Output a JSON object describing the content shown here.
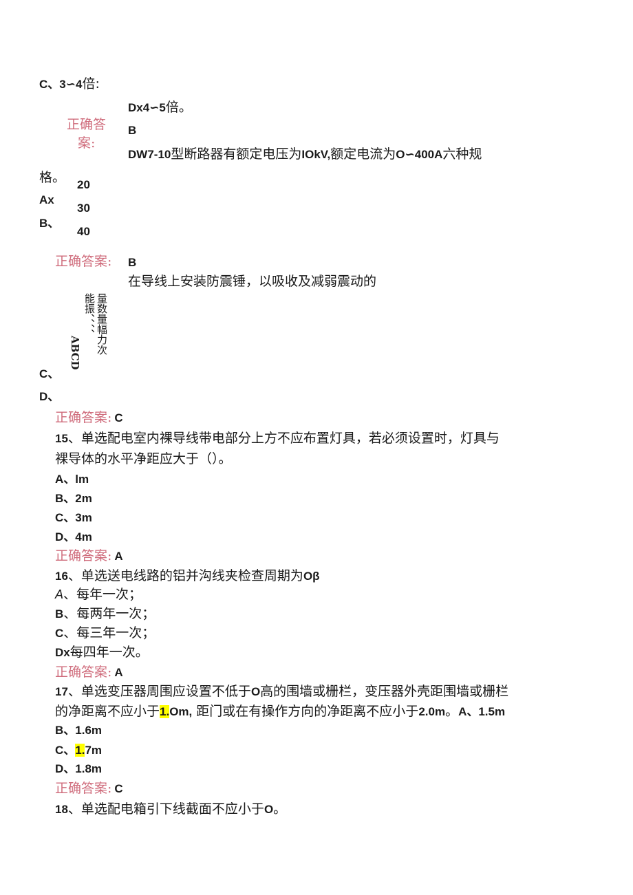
{
  "doc": {
    "q14_tail": {
      "option_c": {
        "label": "C、3∽4",
        "text": "倍:"
      },
      "option_d": {
        "label": "Dx4∽5",
        "text": "倍。"
      },
      "answer_label_line1": "正确答",
      "answer_label_line2": "案:",
      "answer": "B"
    },
    "q_dw7": {
      "stem": [
        "DW7-10",
        "型断路器有额定电压为",
        "IOkV,",
        "额定电流为",
        "O∽400A",
        "六种规"
      ],
      "stem_cont": "格。",
      "option_labels": [
        "Ax",
        "B、"
      ],
      "option_values": [
        "20",
        "30",
        "40"
      ],
      "answer_label": "正确答案:",
      "answer": "B"
    },
    "q_damper": {
      "stem": "在导线上安装防震锤，以吸收及减弱震动的",
      "vertical_col_right": "量数量幅力次",
      "vertical_col_middle": "能振、、、、",
      "vertical_col_left": "ABCD",
      "option_c": "C、",
      "option_d": "D、",
      "answer_label": "正确答案:",
      "answer": "C"
    },
    "q15": {
      "number": "15",
      "stem_line1": "、单选配电室内裸导线带电部分上方不应布置灯具，若必须设置时，灯具与",
      "stem_line2": "裸导体的水平净距应大于（）。",
      "options": [
        {
          "label": "A、",
          "value": "lm"
        },
        {
          "label": "B、",
          "value": "2m"
        },
        {
          "label": "C、",
          "value": "3m"
        },
        {
          "label": "D、",
          "value": "4m"
        }
      ],
      "answer_label": "正确答案:",
      "answer": "A"
    },
    "q16": {
      "number": "16",
      "stem": "、单选送电线路的铝并沟线夹检查周期为",
      "stem_end": "Oβ",
      "options": [
        {
          "label": "A",
          "text": "、每年一次；"
        },
        {
          "label": "B",
          "text": "、每两年一次；"
        },
        {
          "label": "C",
          "text": "、每三年一次；"
        },
        {
          "label": "Dx",
          "text": "每四年一次。"
        }
      ],
      "answer_label": "正确答案:",
      "answer": "A"
    },
    "q17": {
      "number": "17",
      "stem_line1_a": "、单选变压器周围应设置不低于",
      "stem_line1_b": "O",
      "stem_line1_c": "高的围墙或栅栏，变压器外壳距围墙或栅栏",
      "stem_line2_a": "的净距离不应小于",
      "stem_line2_hl": "1.",
      "stem_line2_b": "Om,",
      "stem_line2_c": " 距门或在有操作方向的净距离不应小于",
      "stem_line2_d": "2.0m",
      "stem_line2_e": "。",
      "option_a": "A、1.5m",
      "option_b": "B、1.6m",
      "option_c_label": "C、",
      "option_c_hl": "1.",
      "option_c_rest": "7m",
      "option_d": "D、1.8m",
      "answer_label": "正确答案:",
      "answer": "C"
    },
    "q18": {
      "number": "18",
      "stem": "、单选配电箱引下线截面不应小于",
      "stem_end": "O",
      "stem_tail": "。"
    }
  }
}
